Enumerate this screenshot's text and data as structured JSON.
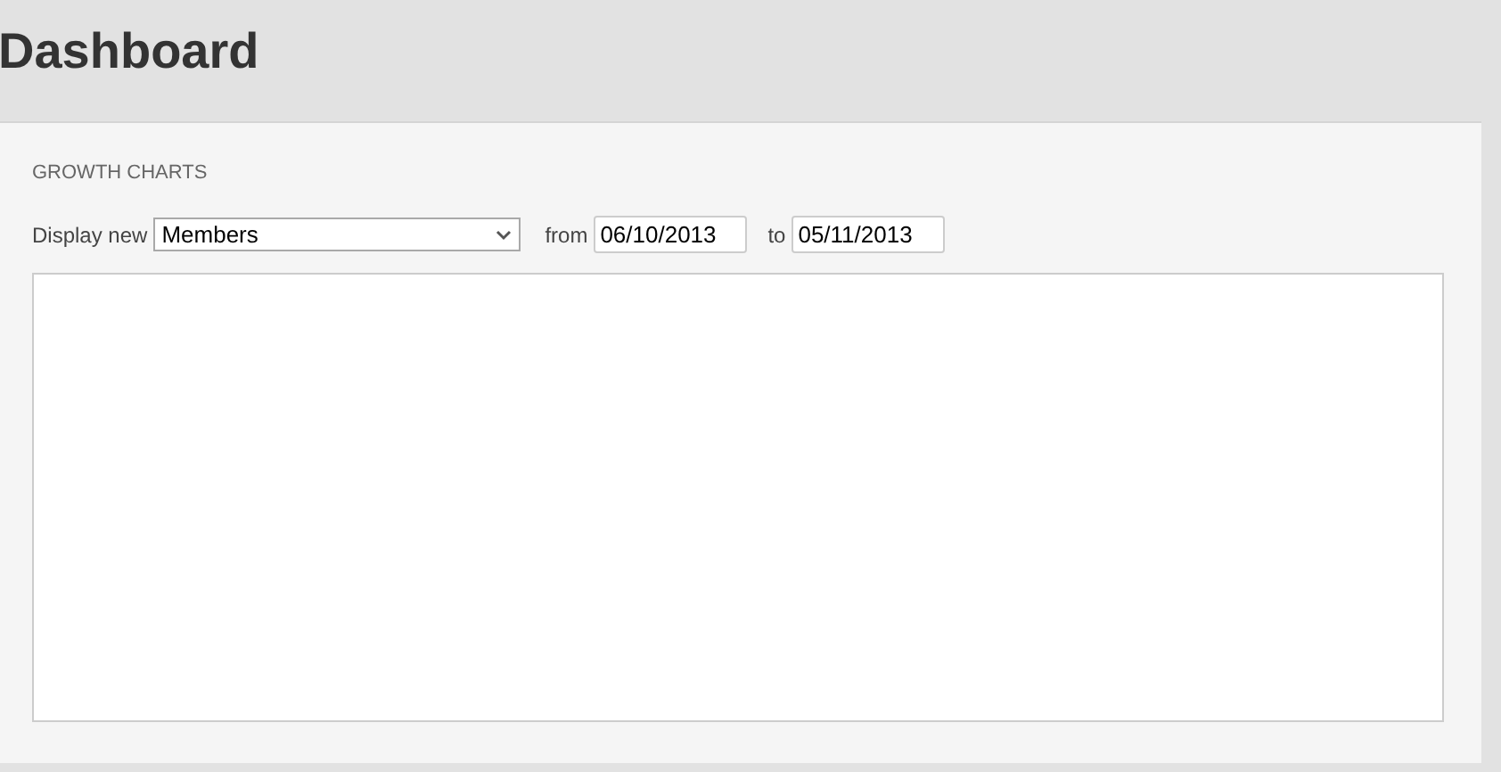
{
  "page_title": "Dashboard",
  "panel": {
    "heading": "GROWTH CHARTS",
    "filters": {
      "display_label": "Display new",
      "display_value": "Members",
      "from_label": "from",
      "from_value": "06/10/2013",
      "to_label": "to",
      "to_value": "05/11/2013"
    }
  }
}
